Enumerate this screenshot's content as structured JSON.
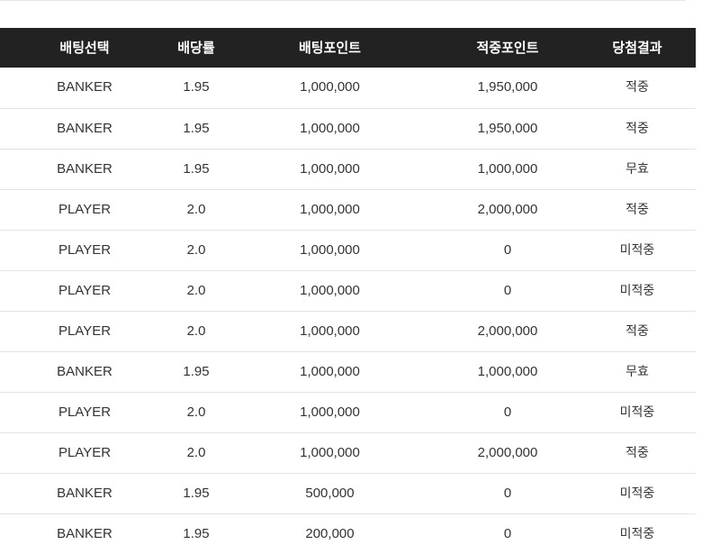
{
  "table": {
    "headers": [
      "배팅선택",
      "배당률",
      "배팅포인트",
      "적중포인트",
      "당첨결과"
    ],
    "rows": [
      [
        "BANKER",
        "1.95",
        "1,000,000",
        "1,950,000",
        "적중"
      ],
      [
        "BANKER",
        "1.95",
        "1,000,000",
        "1,950,000",
        "적중"
      ],
      [
        "BANKER",
        "1.95",
        "1,000,000",
        "1,000,000",
        "무효"
      ],
      [
        "PLAYER",
        "2.0",
        "1,000,000",
        "2,000,000",
        "적중"
      ],
      [
        "PLAYER",
        "2.0",
        "1,000,000",
        "0",
        "미적중"
      ],
      [
        "PLAYER",
        "2.0",
        "1,000,000",
        "0",
        "미적중"
      ],
      [
        "PLAYER",
        "2.0",
        "1,000,000",
        "2,000,000",
        "적중"
      ],
      [
        "BANKER",
        "1.95",
        "1,000,000",
        "1,000,000",
        "무효"
      ],
      [
        "PLAYER",
        "2.0",
        "1,000,000",
        "0",
        "미적중"
      ],
      [
        "PLAYER",
        "2.0",
        "1,000,000",
        "2,000,000",
        "적중"
      ],
      [
        "BANKER",
        "1.95",
        "500,000",
        "0",
        "미적중"
      ],
      [
        "BANKER",
        "1.95",
        "200,000",
        "0",
        "미적중"
      ]
    ]
  },
  "colors": {
    "header_bg": "#222222",
    "header_text": "#ffffff",
    "row_divider": "#e4e4e4",
    "cell_text": "#333333"
  }
}
